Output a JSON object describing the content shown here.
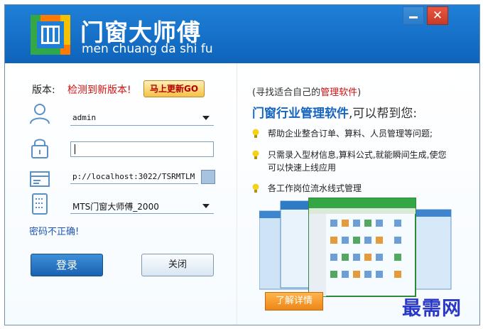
{
  "titlebar": {
    "app_name_cn": "门窗大师傅",
    "app_name_en": "men chuang da shi fu",
    "close_glyph": "✕"
  },
  "login": {
    "version_label": "版本:",
    "version_message": "检测到新版本!",
    "update_button": "马上更新GO",
    "username_value": "admin",
    "password_value": "",
    "server_value": "p://localhost:3022/TSRMTLM",
    "database_value": "MTS门窗大师傅_2000",
    "error_message": "密码不正确!",
    "login_button": "登录",
    "close_button": "关闭"
  },
  "promo": {
    "line1_prefix": "(寻找适合自己的",
    "line1_highlight": "管理软件",
    "line1_suffix": ")",
    "line2_highlight": "门窗行业管理软件",
    "line2_suffix": ",可以帮到您:",
    "features": [
      "帮助企业整合订单、算料、人员管理等问题;",
      "只需录入型材信息,算料公式,就能瞬间生成,使您可以快速上线应用",
      "各工作岗位流水线式管理"
    ],
    "details_button": "了解详情"
  },
  "watermark": "最需网",
  "colors": {
    "title_blue": "#1670c8",
    "error_red": "#d01010",
    "link_blue": "#1f55b3",
    "accent_orange": "#ee8618"
  },
  "icons": [
    "user-icon",
    "lock-icon",
    "server-icon",
    "database-icon",
    "bulb-icon",
    "app-logo-icon"
  ]
}
